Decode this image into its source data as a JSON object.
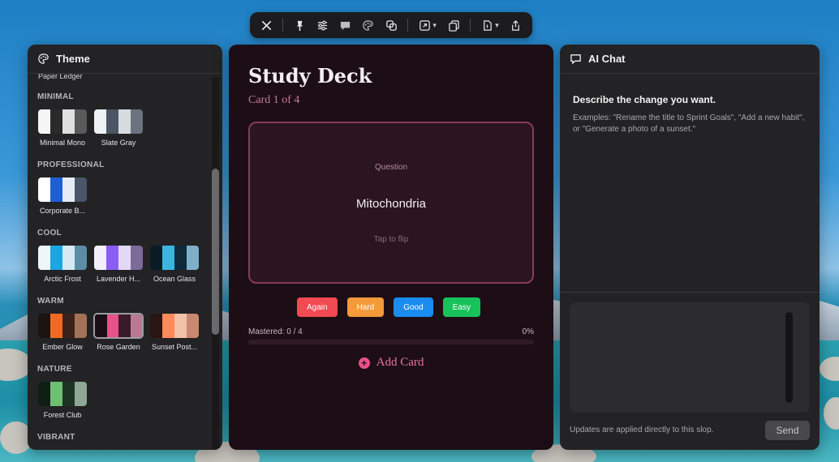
{
  "toolbar": {
    "buttons": [
      "close-icon",
      "pin-icon",
      "sliders-icon",
      "comment-icon",
      "palette-icon",
      "layers-icon",
      "export-icon",
      "copy-icon",
      "document-icon",
      "share-icon"
    ]
  },
  "theme_panel": {
    "title": "Theme",
    "cut_item": "Paper Ledger",
    "sections": [
      {
        "title": "MINIMAL",
        "themes": [
          {
            "name": "Minimal Mono",
            "colors": [
              "#f5f5f5",
              "#2a2a2a",
              "#e0e0e0",
              "#5a5a5a"
            ]
          },
          {
            "name": "Slate Gray",
            "colors": [
              "#eef1f4",
              "#4b5563",
              "#d6dbe0",
              "#6b7280"
            ]
          }
        ]
      },
      {
        "title": "PROFESSIONAL",
        "themes": [
          {
            "name": "Corporate B...",
            "colors": [
              "#ffffff",
              "#1d5fd6",
              "#e6ecf5",
              "#4a5568"
            ]
          }
        ]
      },
      {
        "title": "COOL",
        "themes": [
          {
            "name": "Arctic Frost",
            "colors": [
              "#eef6fa",
              "#1aa6e0",
              "#d7e9f2",
              "#5b8ea6"
            ]
          },
          {
            "name": "Lavender H...",
            "colors": [
              "#f3eefb",
              "#8b5cf6",
              "#e4d9f5",
              "#7c6b9a"
            ]
          },
          {
            "name": "Ocean Glass",
            "colors": [
              "#0b1b26",
              "#3ab5e0",
              "#0f2a3a",
              "#7fb0c8"
            ]
          }
        ]
      },
      {
        "title": "WARM",
        "themes": [
          {
            "name": "Ember Glow",
            "colors": [
              "#1c1210",
              "#f26a21",
              "#3a221a",
              "#a47256"
            ]
          },
          {
            "name": "Rose Garden",
            "colors": [
              "#1d0e16",
              "#e8518a",
              "#3a1a28",
              "#b87a92"
            ],
            "selected": true
          },
          {
            "name": "Sunset Post...",
            "colors": [
              "#2a1512",
              "#ff8a5b",
              "#f4c2a8",
              "#c98870"
            ]
          }
        ]
      },
      {
        "title": "NATURE",
        "themes": [
          {
            "name": "Forest Club",
            "colors": [
              "#0f1f15",
              "#6fbf73",
              "#1c3324",
              "#8fa896"
            ]
          }
        ]
      },
      {
        "title": "VIBRANT",
        "themes": []
      }
    ]
  },
  "deck": {
    "title": "Study Deck",
    "subtitle": "Card 1 of 4",
    "card": {
      "label": "Question",
      "text": "Mitochondria",
      "hint": "Tap to flip"
    },
    "grades": [
      {
        "label": "Again",
        "color": "#f24a52"
      },
      {
        "label": "Hard",
        "color": "#f59a3a"
      },
      {
        "label": "Good",
        "color": "#1a8cf0"
      },
      {
        "label": "Easy",
        "color": "#18c25a"
      }
    ],
    "mastered_text": "Mastered: 0 / 4",
    "percent_text": "0%",
    "progress": 0,
    "add_card_label": "Add Card"
  },
  "chat": {
    "title": "AI Chat",
    "heading": "Describe the change you want.",
    "examples": "Examples: \"Rename the title to Sprint Goals\", \"Add a new habit\", or \"Generate a photo of a sunset.\"",
    "input_value": "",
    "note": "Updates are applied directly to this slop.",
    "send_label": "Send"
  },
  "colors": {
    "accent": "#e8518a",
    "panel_bg": "#232325",
    "deck_bg": "#1d0e16"
  }
}
